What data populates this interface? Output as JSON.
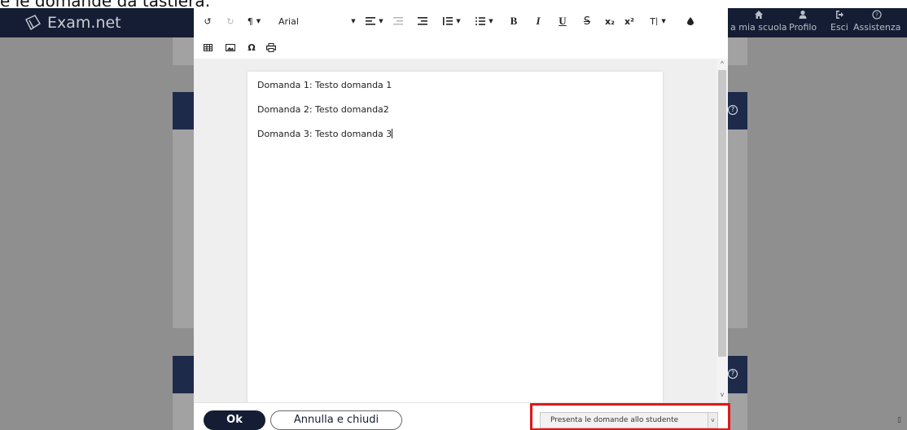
{
  "page_caption": "e le domande da tastiera:",
  "navbar": {
    "brand": "Exam.net",
    "items": [
      {
        "label": "a mia scuola",
        "icon": "home-icon"
      },
      {
        "label": "Profilo",
        "icon": "user-icon"
      },
      {
        "label": "Esci",
        "icon": "logout-icon"
      },
      {
        "label": "Assistenza",
        "icon": "help-icon"
      }
    ]
  },
  "toolbar": {
    "undo": "↺",
    "redo": "↻",
    "paragraph": "¶",
    "font_name": "Arial",
    "bold": "B",
    "italic": "I",
    "underline": "U",
    "strike": "S",
    "subscript": "x₂",
    "superscript": "x²",
    "text_format": "T",
    "omega": "Ω"
  },
  "editor": {
    "lines": [
      "Domanda 1: Testo domanda 1",
      "Domanda 2: Testo domanda2",
      "Domanda 3: Testo domanda 3"
    ]
  },
  "footer": {
    "ok_label": "Ok",
    "cancel_label": "Annulla e chiudi",
    "presentation_select": "Presenta le domande allo studente"
  },
  "colors": {
    "navbar": "#141d33",
    "highlight": "#e01919",
    "overlay": "#8f8f8f"
  }
}
